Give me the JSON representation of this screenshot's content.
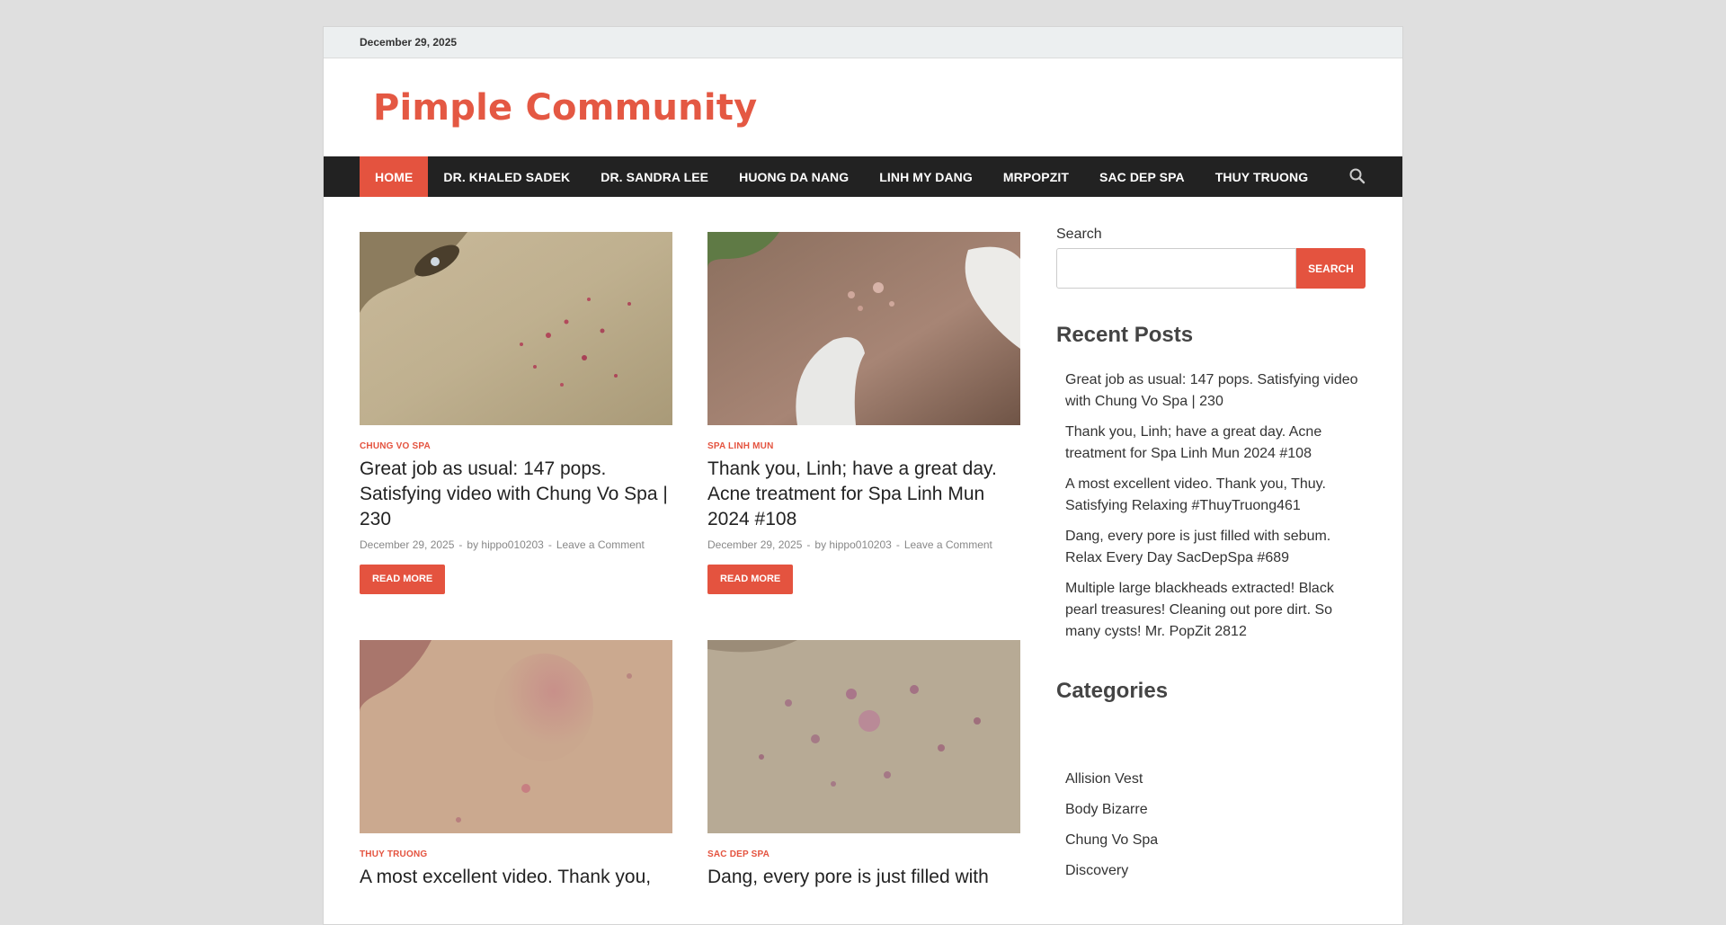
{
  "topbar": {
    "date": "December 29, 2025"
  },
  "site": {
    "title": "Pimple Community"
  },
  "nav": {
    "items": [
      {
        "label": "HOME"
      },
      {
        "label": "DR. KHALED SADEK"
      },
      {
        "label": "DR. SANDRA LEE"
      },
      {
        "label": "HUONG DA NANG"
      },
      {
        "label": "LINH MY DANG"
      },
      {
        "label": "MRPOPZIT"
      },
      {
        "label": "SAC DEP SPA"
      },
      {
        "label": "THUY TRUONG"
      }
    ],
    "search_icon": "search-icon"
  },
  "posts": [
    {
      "category": "CHUNG VO SPA",
      "title": "Great job as usual: 147 pops. Satisfying video with Chung Vo Spa | 230",
      "date": "December 29, 2025",
      "author": "by hippo010203",
      "comment": "Leave a Comment",
      "read_more": "READ MORE"
    },
    {
      "category": "SPA LINH MUN",
      "title": "Thank you, Linh; have a great day. Acne treatment for Spa Linh Mun 2024 #108",
      "date": "December 29, 2025",
      "author": "by hippo010203",
      "comment": "Leave a Comment",
      "read_more": "READ MORE"
    },
    {
      "category": "THUY TRUONG",
      "title": "A most excellent video. Thank you,"
    },
    {
      "category": "SAC DEP SPA",
      "title": "Dang, every pore is just filled with"
    }
  ],
  "meta_separator": "-",
  "sidebar": {
    "search_label": "Search",
    "search_value": "",
    "search_button": "SEARCH",
    "recent_heading": "Recent Posts",
    "recent_posts": [
      "Great job as usual: 147 pops. Satisfying video with Chung Vo Spa | 230",
      "Thank you, Linh; have a great day. Acne treatment for Spa Linh Mun 2024 #108",
      "A most excellent video. Thank you, Thuy. Satisfying Relaxing #ThuyTruong461",
      "Dang, every pore is just filled with sebum. Relax Every Day SacDepSpa #689",
      "Multiple large blackheads extracted! Black pearl treasures! Cleaning out pore dirt. So many cysts! Mr. PopZit 2812"
    ],
    "categories_heading": "Categories",
    "categories": [
      "Allision Vest",
      "Body Bizarre",
      "Chung Vo Spa",
      "Discovery"
    ]
  },
  "colors": {
    "accent": "#e4533f",
    "nav_bg": "#222222",
    "page_bg": "#dfdfdf"
  }
}
